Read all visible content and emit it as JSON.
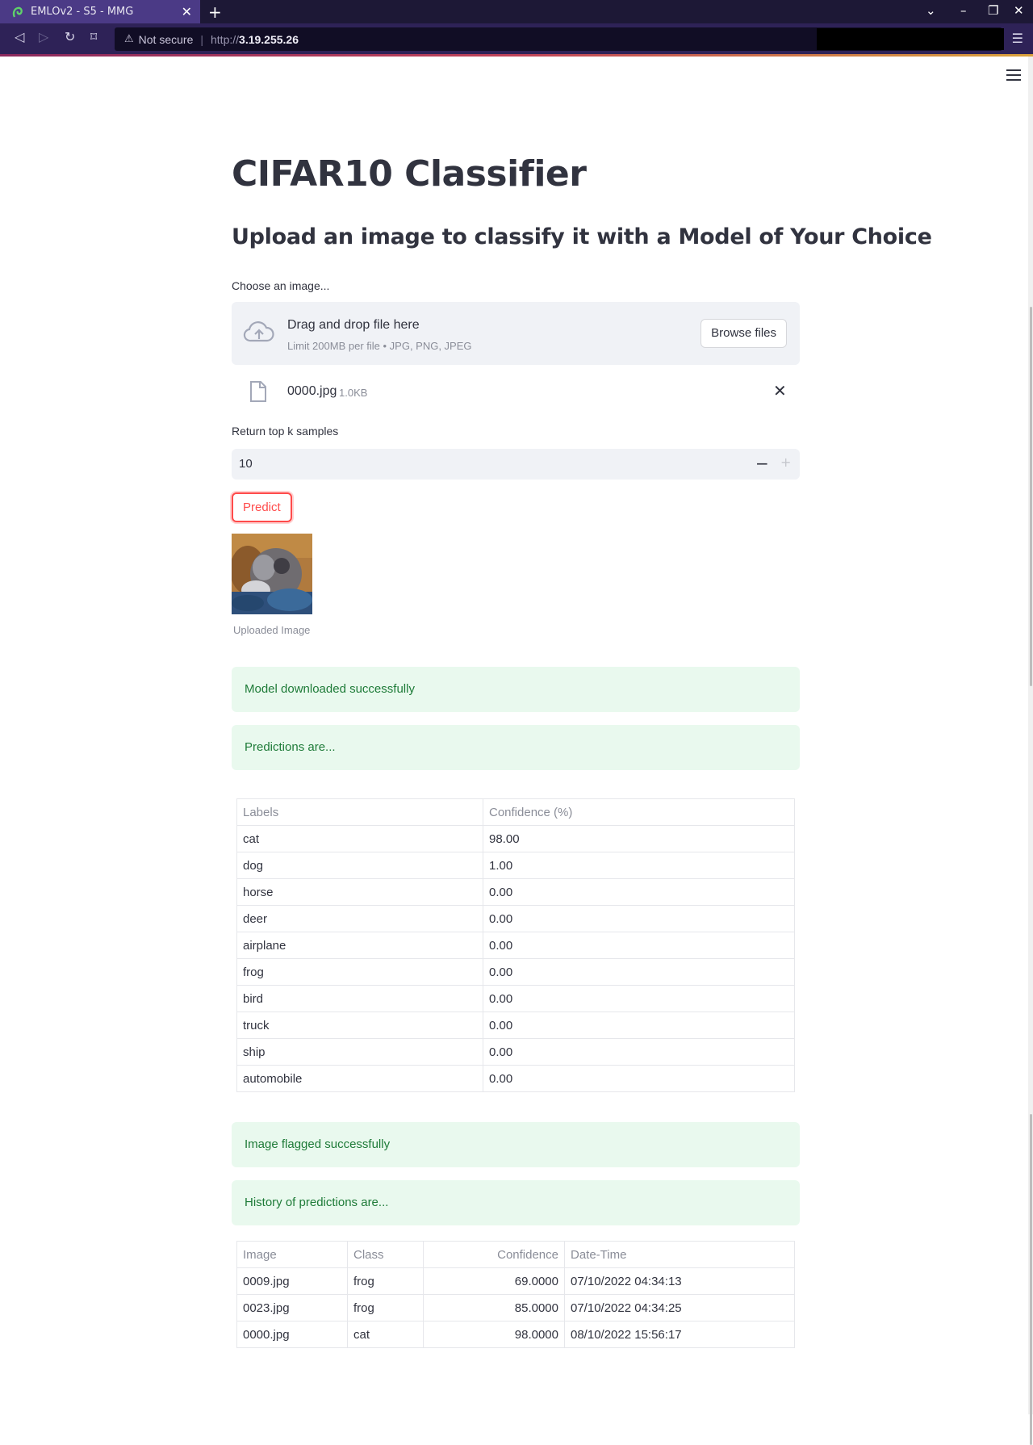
{
  "browser": {
    "tab_title": "EMLOv2 - S5 - MMG",
    "security_label": "Not secure",
    "url_proto": "http://",
    "url_host": "3.19.255.26"
  },
  "app": {
    "title": "CIFAR10 Classifier",
    "subtitle": "Upload an image to classify it with a Model of Your Choice",
    "uploader": {
      "label": "Choose an image...",
      "dropzone_title": "Drag and drop file here",
      "dropzone_limit": "Limit 200MB per file • JPG, PNG, JPEG",
      "browse_label": "Browse files",
      "file_name": "0000.jpg",
      "file_size": "1.0KB"
    },
    "topk": {
      "label": "Return top k samples",
      "value": "10",
      "minus": "−",
      "plus": "+"
    },
    "predict_label": "Predict",
    "image_caption": "Uploaded Image",
    "alerts": {
      "model_downloaded": "Model downloaded successfully",
      "predictions_are": "Predictions are...",
      "flagged": "Image flagged successfully",
      "history_are": "History of predictions are..."
    },
    "predictions_table": {
      "headers": [
        "Labels",
        "Confidence (%)"
      ],
      "rows": [
        [
          "cat",
          "98.00"
        ],
        [
          "dog",
          "1.00"
        ],
        [
          "horse",
          "0.00"
        ],
        [
          "deer",
          "0.00"
        ],
        [
          "airplane",
          "0.00"
        ],
        [
          "frog",
          "0.00"
        ],
        [
          "bird",
          "0.00"
        ],
        [
          "truck",
          "0.00"
        ],
        [
          "ship",
          "0.00"
        ],
        [
          "automobile",
          "0.00"
        ]
      ]
    },
    "history_table": {
      "headers": [
        "Image",
        "Class",
        "Confidence",
        "Date-Time"
      ],
      "rows": [
        [
          "0009.jpg",
          "frog",
          "69.0000",
          "07/10/2022 04:34:13"
        ],
        [
          "0023.jpg",
          "frog",
          "85.0000",
          "07/10/2022 04:34:25"
        ],
        [
          "0000.jpg",
          "cat",
          "98.0000",
          "08/10/2022 15:56:17"
        ]
      ]
    }
  },
  "colors": {
    "primary": "#ff4b4b",
    "success_bg": "#e9f9ee",
    "success_text": "#1e7b38",
    "browser_tab": "#4b3a86",
    "browser_nav": "#2e2257"
  }
}
